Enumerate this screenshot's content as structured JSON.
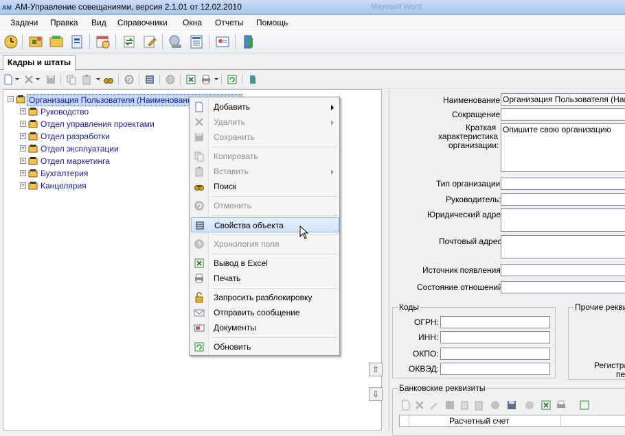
{
  "window": {
    "title": "AM-Управление совещаниями, версия 2.1.01 от 12.02.2010",
    "background_title": "Microsoft Word",
    "app_icon_text": "AM"
  },
  "menu": [
    "Задачи",
    "Правка",
    "Вид",
    "Справочники",
    "Окна",
    "Отчеты",
    "Помощь"
  ],
  "tab": {
    "label": "Кадры и штаты"
  },
  "tree": {
    "root": "Организация Пользователя (Наименование структуры)",
    "children": [
      "Руководство",
      "Отдел управления проектами",
      "Отдел разработки",
      "Отдел эксплуатации",
      "Отдел маркетинга",
      "Бухгалтерия",
      "Канцелярия"
    ]
  },
  "context_menu": {
    "items": [
      {
        "label": "Добавить",
        "enabled": true,
        "submenu": true,
        "icon": "new-document-icon"
      },
      {
        "label": "Удалить",
        "enabled": false,
        "submenu": true,
        "icon": "delete-x-icon"
      },
      {
        "label": "Сохранить",
        "enabled": false,
        "submenu": false,
        "icon": "save-floppy-icon"
      },
      {
        "label": "Копировать",
        "enabled": false,
        "submenu": false,
        "icon": "copy-icon"
      },
      {
        "label": "Вставить",
        "enabled": false,
        "submenu": true,
        "icon": "paste-icon"
      },
      {
        "label": "Поиск",
        "enabled": true,
        "submenu": false,
        "icon": "binoculars-icon"
      },
      {
        "label": "Отменить",
        "enabled": false,
        "submenu": false,
        "icon": "undo-icon"
      },
      {
        "label": "Свойства объекта",
        "enabled": true,
        "submenu": false,
        "icon": "properties-icon",
        "highlighted": true
      },
      {
        "label": "Хронология поля",
        "enabled": false,
        "submenu": false,
        "icon": "history-icon"
      },
      {
        "label": "Вывод в Excel",
        "enabled": true,
        "submenu": false,
        "icon": "excel-icon"
      },
      {
        "label": "Печать",
        "enabled": true,
        "submenu": false,
        "icon": "printer-icon"
      },
      {
        "label": "Запросить разблокировку",
        "enabled": true,
        "submenu": false,
        "icon": "unlock-icon"
      },
      {
        "label": "Отправить сообщение",
        "enabled": true,
        "submenu": false,
        "icon": "envelope-icon"
      },
      {
        "label": "Документы",
        "enabled": true,
        "submenu": false,
        "icon": "documents-icon"
      },
      {
        "label": "Обновить",
        "enabled": true,
        "submenu": false,
        "icon": "refresh-icon"
      }
    ]
  },
  "props": {
    "name_label": "Наименование:",
    "name_value": "Организация Пользователя (Наим",
    "short_label": "Сокращение:",
    "short_value": "",
    "desc_label_1": "Краткая",
    "desc_label_2": "характеристика",
    "desc_label_3": "организации:",
    "desc_value": "Опишите свою организацию",
    "type_label": "Тип организации:",
    "head_label": "Руководитель:",
    "legal_label": "Юридический адрес:",
    "postal_label": "Почтовый адрес:",
    "source_label": "Источник появления:",
    "relation_label": "Состояние отношений:",
    "codes_group": "Коды",
    "ogrn_label": "ОГРН:",
    "inn_label": "ИНН:",
    "okpo_label": "ОКПО:",
    "okved_label": "ОКВЭД:",
    "other_group": "Прочие реквиз",
    "reg_label_1": "Регистра",
    "reg_label_2": "пе",
    "bank_group": "Банковские реквизиты",
    "bank_col_account": "Расчетный счет"
  },
  "colors": {
    "selection": "#c2daf6",
    "menu_highlight": "#cfe3f9",
    "link_text": "#1a1aa8"
  }
}
